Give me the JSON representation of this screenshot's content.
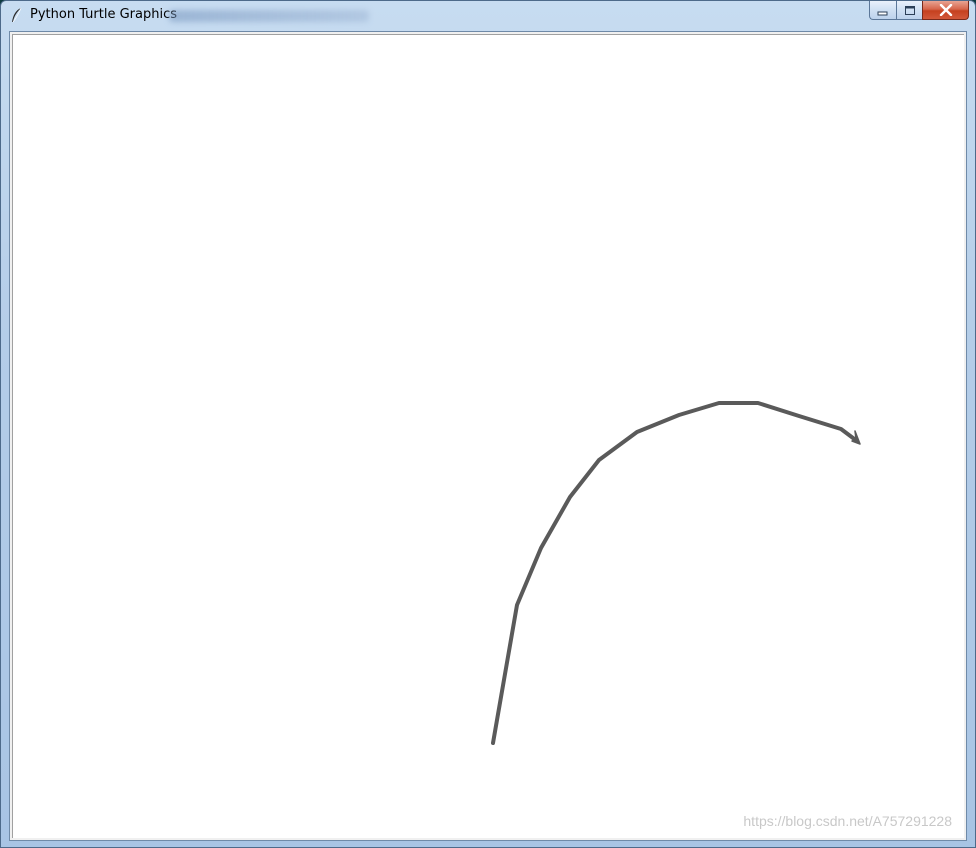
{
  "window": {
    "title": "Python Turtle Graphics",
    "app_icon": "feather-icon",
    "caption_buttons": {
      "minimize_icon": "minimize-icon",
      "maximize_icon": "maximize-icon",
      "close_icon": "close-icon"
    }
  },
  "canvas": {
    "background": "#ffffff",
    "pen_color": "#5a5a5a",
    "turtle_shape": "classic-arrow"
  },
  "watermark": "https://blog.csdn.net/A757291228"
}
